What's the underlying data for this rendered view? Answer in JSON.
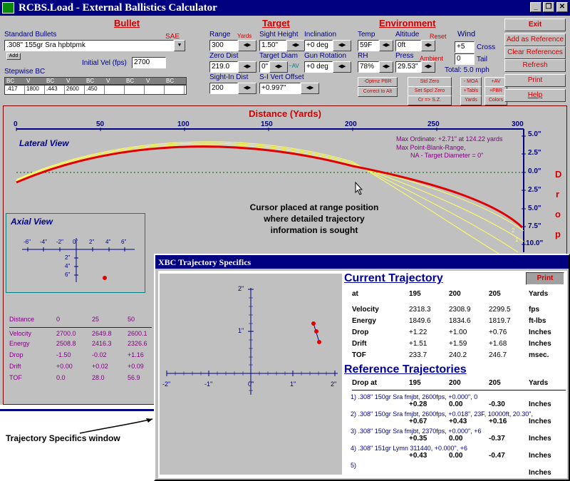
{
  "window": {
    "title": "RCBS.Load  -  External Ballistics Calculator",
    "min": "_",
    "restore": "❐",
    "close": "✕"
  },
  "bullet": {
    "section": "Bullet",
    "std_bullets_label": "Standard Bullets",
    "sae_label": "SAE",
    "bullet_value": ".308\"  155gr  Sra    hpbtpmk",
    "add_label": "Add",
    "init_vel_label": "Initial Vel (fps)",
    "init_vel_value": "2700",
    "stepwise_label": "Stepwise BC",
    "bc_headers": [
      "BC",
      "V",
      "BC",
      "V",
      "BC",
      "V",
      "BC",
      "V",
      "BC"
    ],
    "bc_values": [
      ".417",
      "1800",
      ".443",
      "2600",
      ".450",
      "",
      "",
      "",
      ""
    ]
  },
  "target": {
    "section": "Target",
    "range_label": "Range",
    "yards_label": "Yards",
    "range_value": "300",
    "sight_height_label": "Sight Height",
    "sight_height_value": "1.50\"",
    "inclination_label": "Inclination",
    "inclination_value": "+0 deg",
    "zero_dist_label": "Zero Dist",
    "zero_dist_value": "219.0",
    "target_diam_label": "Target Diam",
    "target_diam_value": "0\"",
    "target_diam_av": "~AV",
    "gun_rotation_label": "Gun Rotation",
    "gun_rotation_value": "+0 deg",
    "sight_in_label": "Sight-In Dist",
    "sight_in_value": "200",
    "si_vert_label": "S-I Vert Offset",
    "si_vert_value": "+0.997\""
  },
  "environment": {
    "section": "Environment",
    "temp_label": "Temp",
    "temp_value": "59F",
    "altitude_label": "Altitude",
    "altitude_value": "0ft",
    "reset_label": "Reset",
    "wind_label": "Wind",
    "wind_cross_value": "+5",
    "cross_label": "Cross",
    "wind_tail_value": "0",
    "tail_label": "Tail",
    "rh_label": "RH",
    "rh_value": "78%",
    "press_label": "Press",
    "press_value": "29.53\"",
    "ambient_label": "Ambient",
    "total_label": "Total:  5.0 mph"
  },
  "buttons": {
    "optimz_pbr": "-Optmz PBR",
    "correct_to_alt": "Correct to Alt",
    "std_zero": "Std Zero",
    "set_spcl_zero": "Set Spcl Zero",
    "cr_sz": "Cr => S.Z.",
    "moa": "- MOA",
    "tabls": "+Tabls",
    "yards": "Yards",
    "av": "+AV",
    "fbr": "+FBR",
    "colors": "Colors",
    "exit": "Exit",
    "add_ref": "Add as Reference",
    "clear_ref": "Clear References",
    "refresh": "Refresh",
    "print": "Print",
    "help": "Help"
  },
  "plot": {
    "distance_title": "Distance  (Yards)",
    "x_ticks": [
      "0",
      "50",
      "100",
      "150",
      "200",
      "250",
      "300"
    ],
    "y_ticks": [
      "5.0\"",
      "2.5\"",
      "0.0\"",
      "2.5\"",
      "5.0\"",
      "7.5\"",
      "10.0\""
    ],
    "drop_letters": [
      "D",
      "r",
      "o",
      "p"
    ],
    "lateral_view": "Lateral View",
    "max_ordinate": "Max Ordinate: +2.71\" at 124.22 yards",
    "max_pbr": "Max Point-Blank-Range,",
    "na_target": "NA - Target Diameter = 0\"",
    "cursor_note_1": "Cursor placed at range position",
    "cursor_note_2": "where detailed trajectory",
    "cursor_note_3": "information is sought",
    "curve_labels": [
      "2",
      "1"
    ],
    "axial_view": "Axial View",
    "axial_ticks": [
      "-6\"",
      "-4\"",
      "-2\"",
      "0\"",
      "2\"",
      "4\"",
      "6\""
    ],
    "axial_vticks": [
      "2\"",
      "4\"",
      "6\""
    ],
    "table": {
      "distance": [
        "Distance",
        "0",
        "25",
        "50"
      ],
      "velocity": [
        "Velocity",
        "2700.0",
        "2649.8",
        "2600.1"
      ],
      "energy": [
        "Energy",
        "2508.8",
        "2416.3",
        "2326.6"
      ],
      "drop": [
        "Drop",
        "-1.50",
        "-0.02",
        "+1.16"
      ],
      "drift": [
        "Drift",
        "+0.00",
        "+0.02",
        "+0.09"
      ],
      "tof": [
        "TOF",
        "0.0",
        "28.0",
        "56.9"
      ]
    },
    "specifics_note": "Trajectory Specifics window"
  },
  "xbc": {
    "title": "XBC Trajectory Specifics",
    "print": "Print",
    "grid_ticks": [
      "-2\"",
      "-1\"",
      "0\"",
      "1\"",
      "2\""
    ],
    "grid_vticks": [
      "2\"",
      "1\""
    ],
    "current_title": "Current Trajectory",
    "headers": [
      "at",
      "195",
      "200",
      "205",
      "Yards"
    ],
    "rows": [
      [
        "Velocity",
        "2318.3",
        "2308.9",
        "2299.5",
        "fps"
      ],
      [
        "Energy",
        "1849.6",
        "1834.6",
        "1819.7",
        "ft-lbs"
      ],
      [
        "Drop",
        "+1.22",
        "+1.00",
        "+0.76",
        "Inches"
      ],
      [
        "Drift",
        "+1.51",
        "+1.59",
        "+1.68",
        "Inches"
      ],
      [
        "TOF",
        "233.7",
        "240.2",
        "246.7",
        "msec."
      ]
    ],
    "ref_title": "Reference Trajectories",
    "ref_headers": [
      "Drop at",
      "195",
      "200",
      "205",
      "Yards"
    ],
    "refs": [
      {
        "desc": "1)  .308\" 150gr Sra fmjbt, 2600fps, +0.000\",  0",
        "vals": [
          "+0.28",
          "0.00",
          "-0.30",
          "Inches"
        ]
      },
      {
        "desc": "2)  .308\" 150gr Sra fmjbt, 2600fps, +0.018\", 23F, 10000ft, 20.30\",",
        "vals": [
          "+0.67",
          "+0.43",
          "+0.16",
          "Inches"
        ]
      },
      {
        "desc": "3)  .308\" 150gr Sra fmjbt, 2370fps, +0.000\", +6",
        "vals": [
          "+0.35",
          "0.00",
          "-0.37",
          "Inches"
        ]
      },
      {
        "desc": "4)  .308\" 151gr Lymn 311440, +0.000\",  +6",
        "vals": [
          "+0.43",
          "0.00",
          "-0.47",
          "Inches"
        ]
      },
      {
        "desc": "5)",
        "vals": [
          "",
          "",
          "",
          "Inches"
        ]
      }
    ]
  },
  "colors": {
    "title_bar": "#000080",
    "accent_red": "#d00000",
    "navy": "#000080",
    "trajectory": "#e00000",
    "refs": "#ffff60"
  }
}
